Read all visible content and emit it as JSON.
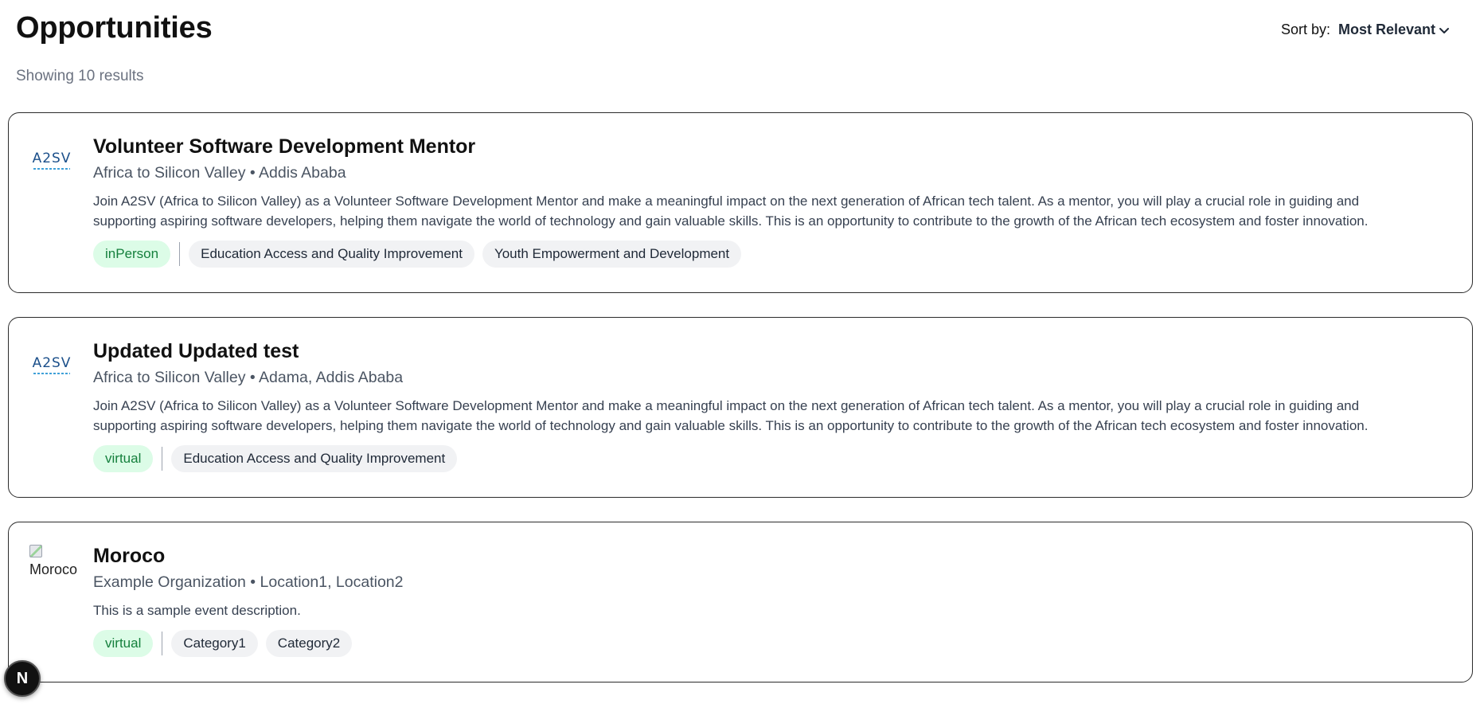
{
  "header": {
    "title": "Opportunities",
    "results": "Showing 10 results",
    "sort_label": "Sort by:",
    "sort_value": "Most Relevant"
  },
  "cards": [
    {
      "logo": "A2SV",
      "title": "Volunteer Software Development Mentor",
      "subtitle": "Africa to Silicon Valley • Addis Ababa",
      "description": "Join A2SV (Africa to Silicon Valley) as a Volunteer Software Development Mentor and make a meaningful impact on the next generation of African tech talent. As a mentor, you will play a crucial role in guiding and supporting aspiring software developers, helping them navigate the world of technology and gain valuable skills. This is an opportunity to contribute to the growth of the African tech ecosystem and foster innovation.",
      "mode": "inPerson",
      "tags": [
        "Education Access and Quality Improvement",
        "Youth Empowerment and Development"
      ]
    },
    {
      "logo": "A2SV",
      "title": "Updated Updated test",
      "subtitle": "Africa to Silicon Valley • Adama, Addis Ababa",
      "description": "Join A2SV (Africa to Silicon Valley) as a Volunteer Software Development Mentor and make a meaningful impact on the next generation of African tech talent. As a mentor, you will play a crucial role in guiding and supporting aspiring software developers, helping them navigate the world of technology and gain valuable skills. This is an opportunity to contribute to the growth of the African tech ecosystem and foster innovation.",
      "mode": "virtual",
      "tags": [
        "Education Access and Quality Improvement"
      ]
    },
    {
      "logo_alt": "Moroco",
      "title": "Moroco",
      "subtitle": "Example Organization • Location1, Location2",
      "description": "This is a sample event description.",
      "mode": "virtual",
      "tags": [
        "Category1",
        "Category2"
      ]
    }
  ],
  "floating_badge": "N",
  "colors": {
    "mode_bg": "#dcfce7",
    "mode_text": "#15803d",
    "tag_bg": "#f1f2f4",
    "logo_blue": "#1b4f8a"
  }
}
